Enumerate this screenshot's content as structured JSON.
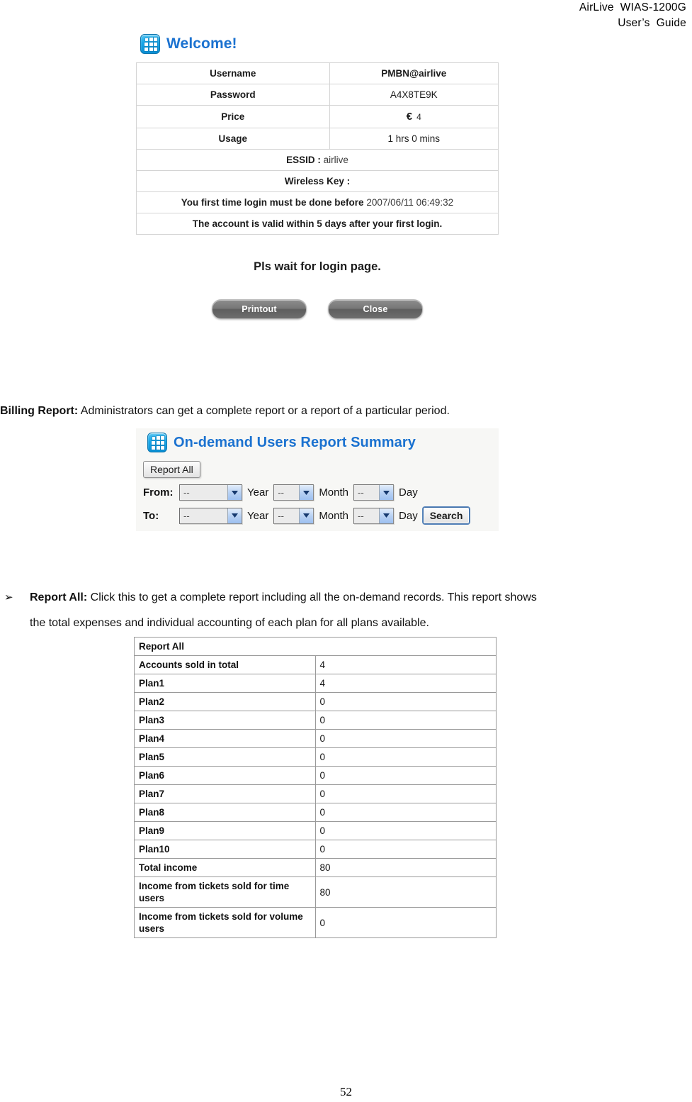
{
  "header": {
    "line1": "AirLive  WIAS-1200G",
    "line2": "User’s  Guide"
  },
  "welcome_screen": {
    "icon": "grid-icon",
    "title": "Welcome!",
    "rows": [
      {
        "label": "Username",
        "value": "PMBN@airlive"
      },
      {
        "label": "Password",
        "value": "A4X8TE9K"
      },
      {
        "label": "Price",
        "value": "€",
        "amount": "4"
      },
      {
        "label": "Usage",
        "value": "1 hrs 0 mins"
      }
    ],
    "essid_label": "ESSID :",
    "essid_value": "airlive",
    "wireless_key_label": "Wireless Key :",
    "wireless_key_value": "",
    "first_login_label": "You first time login must be done before",
    "first_login_value": "2007/06/11 06:49:32",
    "validity_note": "The account is valid within 5 days after your first login.",
    "wait_text": "Pls wait for login page.",
    "buttons": {
      "printout": "Printout",
      "close": "Close"
    }
  },
  "billing_paragraph": {
    "lead": "Billing Report:",
    "text": " Administrators can get a complete report or a report of a particular period."
  },
  "summary_screen": {
    "icon": "grid-icon",
    "title": "On-demand Users Report Summary",
    "report_all_button": "Report All",
    "from": {
      "label": "From:",
      "year_value": "--",
      "year_unit": "Year",
      "month_value": "--",
      "month_unit": "Month",
      "day_value": "--",
      "day_unit": "Day"
    },
    "to": {
      "label": "To:",
      "year_value": "--",
      "year_unit": "Year",
      "month_value": "--",
      "month_unit": "Month",
      "day_value": "--",
      "day_unit": "Day"
    },
    "search_button": "Search"
  },
  "report_all_paragraph": {
    "bullet": "➢",
    "lead": "Report All:",
    "line1": " Click this to get a complete report including all the on-demand records. This report shows",
    "line2": "the total expenses and individual accounting of each plan for all plans available."
  },
  "report_table": {
    "title": "Report All",
    "rows": [
      {
        "label": "Accounts sold in total",
        "value": "4"
      },
      {
        "label": "Plan1",
        "value": "4"
      },
      {
        "label": "Plan2",
        "value": "0"
      },
      {
        "label": "Plan3",
        "value": "0"
      },
      {
        "label": "Plan4",
        "value": "0"
      },
      {
        "label": "Plan5",
        "value": "0"
      },
      {
        "label": "Plan6",
        "value": "0"
      },
      {
        "label": "Plan7",
        "value": "0"
      },
      {
        "label": "Plan8",
        "value": "0"
      },
      {
        "label": "Plan9",
        "value": "0"
      },
      {
        "label": "Plan10",
        "value": "0"
      },
      {
        "label": "Total income",
        "value": "80"
      },
      {
        "label": "Income from tickets sold for time users",
        "value": "80"
      },
      {
        "label": "Income from tickets sold for volume users",
        "value": "0"
      }
    ]
  },
  "footer": {
    "page_number": "52"
  },
  "colors": {
    "title_blue": "#1b72d0",
    "icon_blue": "#16a6e8"
  }
}
